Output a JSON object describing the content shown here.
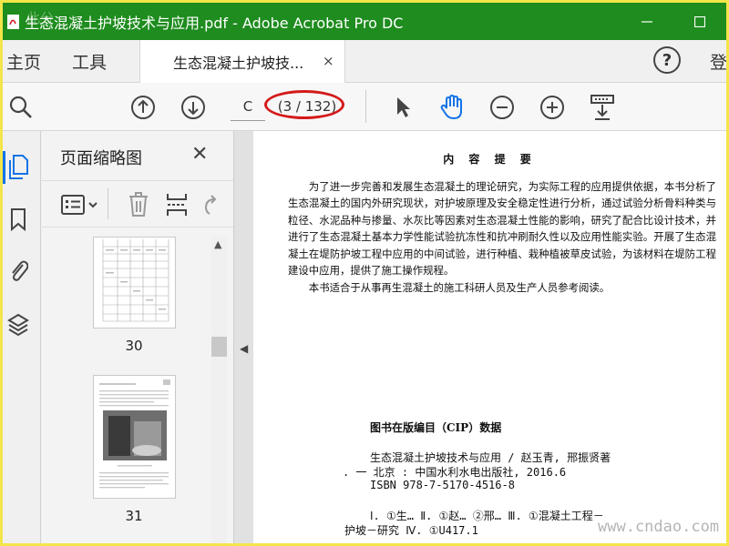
{
  "window": {
    "title": "生态混凝土护坡技术与应用.pdf - Adobe Acrobat Pro DC",
    "watermark": "此分"
  },
  "nav": {
    "home": "主页",
    "tools": "工具",
    "login": "登",
    "help": "?"
  },
  "tab": {
    "label": "生态混凝土护坡技...",
    "close": "×"
  },
  "toolbar": {
    "page_input": "C",
    "page_count": "(3 / 132)"
  },
  "thumbnails": {
    "title": "页面缩略图",
    "pages": [
      {
        "number": "30"
      },
      {
        "number": "31"
      }
    ]
  },
  "document": {
    "heading": "内 容 提 要",
    "paragraphs": [
      "为了进一步完善和发展生态混凝土的理论研究，为实际工程的应用提供依据，本书分析了生态混凝土的国内外研究现状，对护坡原理及安全稳定性进行分析，通过试验分析骨料种类与粒径、水泥品种与掺量、水灰比等因素对生态混凝土性能的影响，研究了配合比设计技术，并进行了生态混凝土基本力学性能试验抗冻性和抗冲刷耐久性以及应用性能实验。开展了生态混凝土在堤防护坡工程中应用的中间试验，进行种植、栽种植被草皮试验，为该材料在堤防工程建设中应用，提供了施工操作规程。",
      "本书适合于从事再生混凝土的施工科研人员及生产人员参考阅读。"
    ],
    "cip_title": "图书在版编目（CIP）数据",
    "cip_lines": [
      "生态混凝土护坡技术与应用 / 赵玉青, 邢振贤著",
      ". 一 北京 : 中国水利水电出版社, 2016.6",
      "ISBN 978-7-5170-4516-8",
      "Ⅰ. ①生… Ⅱ. ①赵… ②邢… Ⅲ. ①混凝土工程－",
      "护坡－研究 Ⅳ. ①U417.1"
    ],
    "watermark": "www.cndao.com"
  },
  "colors": {
    "titlebar": "#1e8c1e",
    "highlight": "#d41a1a",
    "active_icon": "#1473e6"
  }
}
